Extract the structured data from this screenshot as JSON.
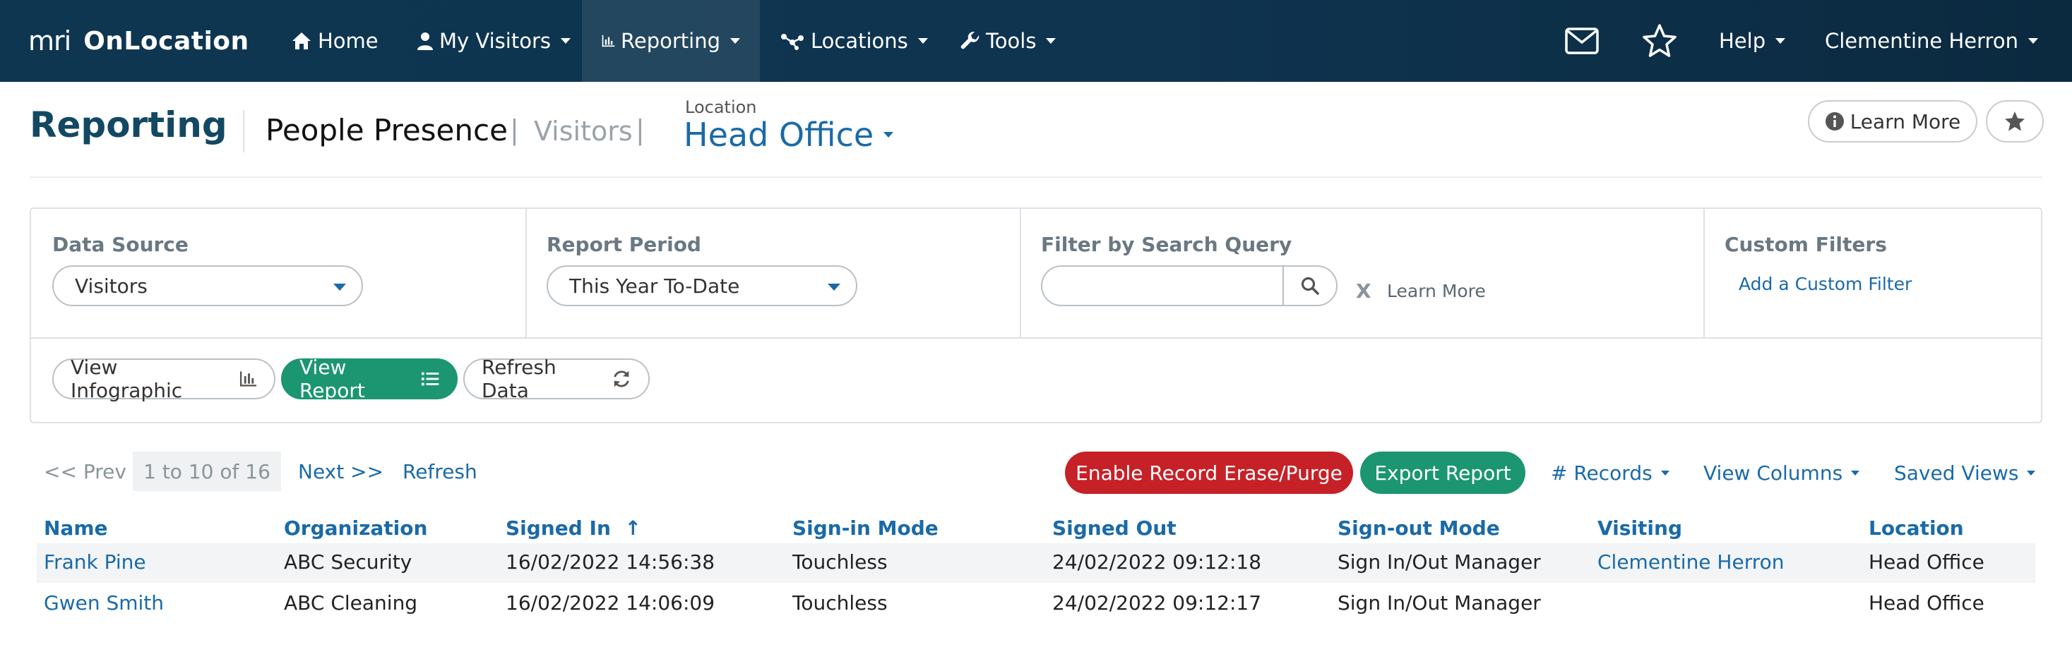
{
  "nav": {
    "brand_mri": "mri",
    "brand_name": "OnLocation",
    "items": [
      {
        "label": "Home",
        "icon": "home-icon"
      },
      {
        "label": "My Visitors",
        "icon": "user-icon"
      },
      {
        "label": "Reporting",
        "icon": "bar-chart-icon",
        "active": true
      },
      {
        "label": "Locations",
        "icon": "network-icon"
      },
      {
        "label": "Tools",
        "icon": "wrench-icon"
      }
    ],
    "help_label": "Help",
    "user_label": "Clementine Herron",
    "colors": {
      "bar": "#0e3651",
      "accent": "#3fb8c4"
    }
  },
  "header": {
    "title": "Reporting",
    "tabs": [
      {
        "label": "People Presence",
        "active": true
      },
      {
        "label": "Visitors",
        "active": false
      }
    ],
    "separator": "|",
    "location_label": "Location",
    "location_value": "Head Office",
    "learn_more_label": "Learn More"
  },
  "filters": {
    "data_source_label": "Data Source",
    "data_source_value": "Visitors",
    "report_period_label": "Report Period",
    "report_period_value": "This Year To-Date",
    "search_label": "Filter by Search Query",
    "search_value": "",
    "search_placeholder": "",
    "clear_label": "X",
    "learn_more_label": "Learn More",
    "custom_filters_label": "Custom Filters",
    "add_custom_filter_label": "Add a Custom Filter"
  },
  "actions": {
    "view_infographic": "View Infographic",
    "view_report": "View Report",
    "refresh_data": "Refresh Data"
  },
  "pager": {
    "prev": "<< Prev",
    "range": "1 to 10 of 16",
    "next": "Next >>",
    "refresh": "Refresh"
  },
  "toolbar": {
    "erase_purge": "Enable Record Erase/Purge",
    "export": "Export Report",
    "records": "# Records",
    "view_columns": "View Columns",
    "saved_views": "Saved Views",
    "colors": {
      "danger": "#c62127",
      "success": "#1b9670",
      "link": "#1a6aa8"
    }
  },
  "table": {
    "columns": [
      "Name",
      "Organization",
      "Signed In",
      "Sign-in Mode",
      "Signed Out",
      "Sign-out Mode",
      "Visiting",
      "Location"
    ],
    "sort_indicator": "↑",
    "rows": [
      {
        "name": "Frank Pine",
        "organization": "ABC Security",
        "signed_in": "16/02/2022 14:56:38",
        "sign_in_mode": "Touchless",
        "signed_out": "24/02/2022 09:12:18",
        "sign_out_mode": "Sign In/Out Manager",
        "visiting": "Clementine Herron",
        "location": "Head Office"
      },
      {
        "name": "Gwen Smith",
        "organization": "ABC Cleaning",
        "signed_in": "16/02/2022 14:06:09",
        "sign_in_mode": "Touchless",
        "signed_out": "24/02/2022 09:12:17",
        "sign_out_mode": "Sign In/Out Manager",
        "visiting": "",
        "location": "Head Office"
      }
    ]
  }
}
